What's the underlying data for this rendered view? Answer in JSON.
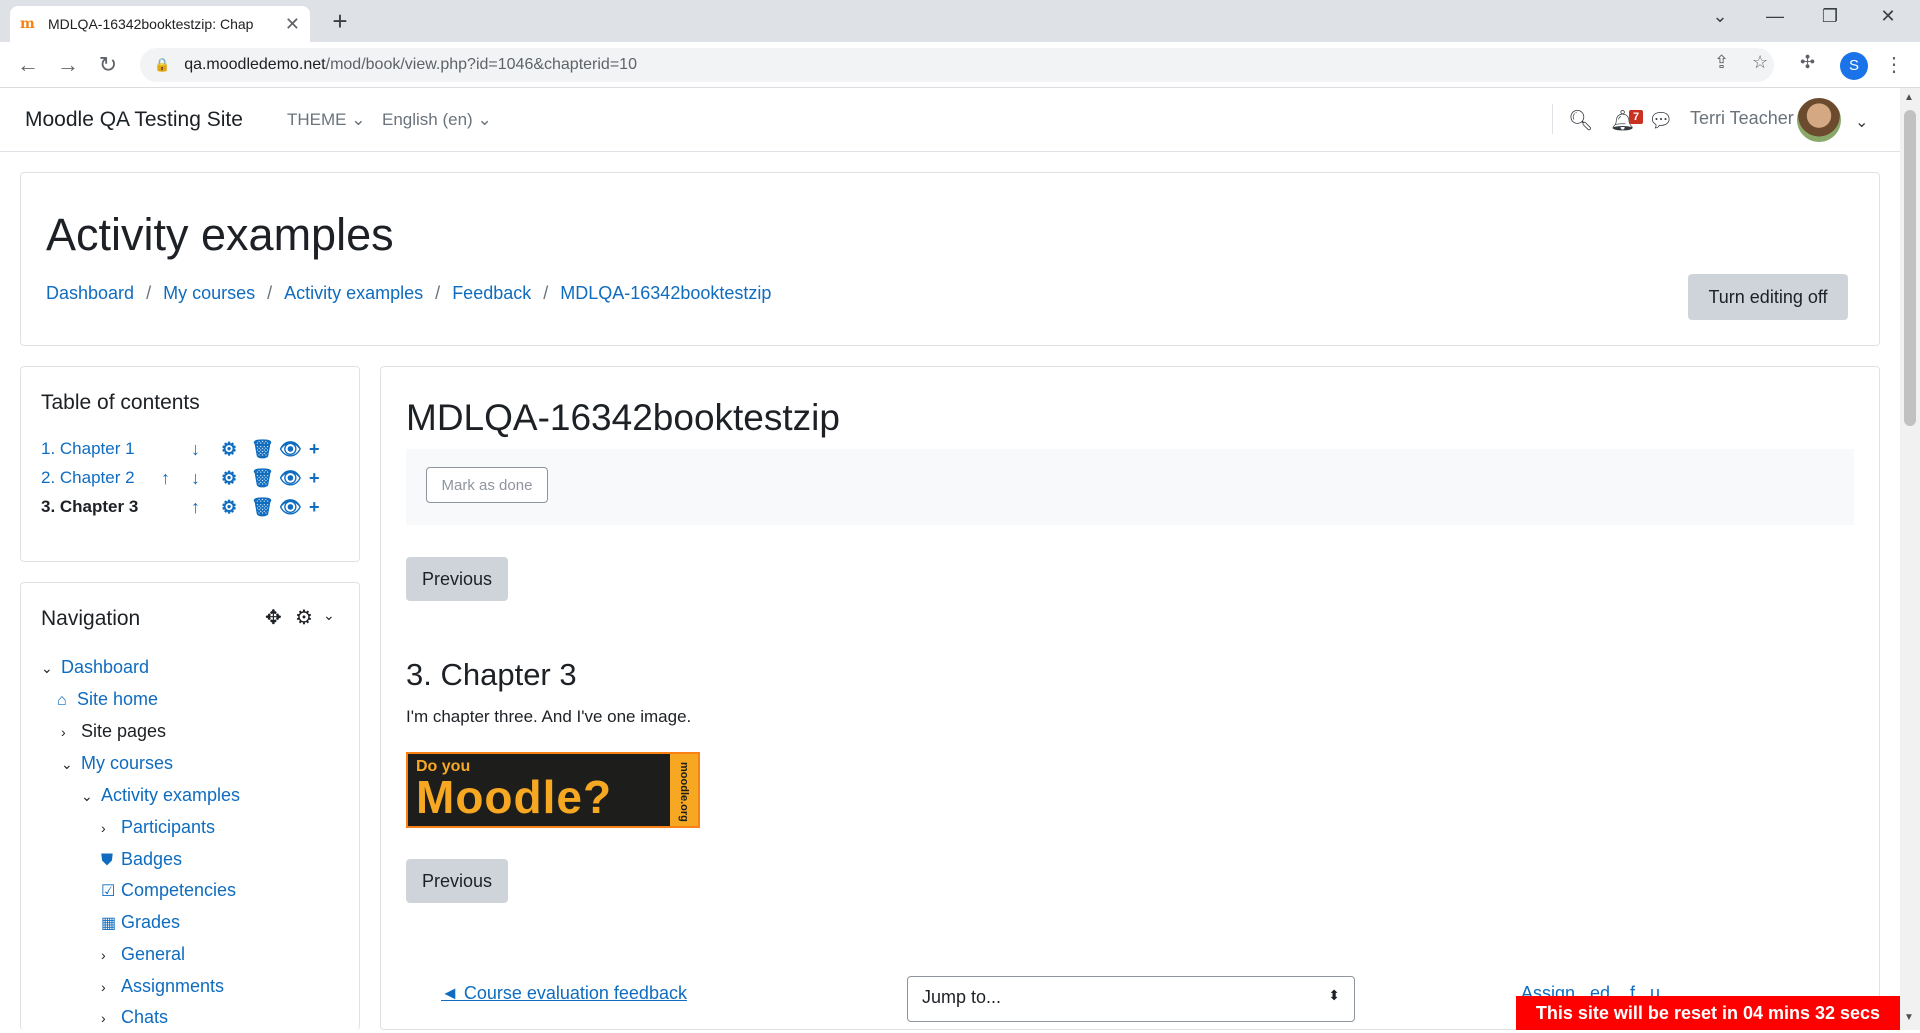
{
  "browser": {
    "tab_title": "MDLQA-16342booktestzip: Chap",
    "url_host": "qa.moodledemo.net",
    "url_path": "/mod/book/view.php?id=1046&chapterid=10",
    "profile_initial": "S"
  },
  "navbar": {
    "site_name": "Moodle QA Testing Site",
    "theme_label": "THEME",
    "language_label": "English (en)",
    "notification_count": "7",
    "user_name": "Terri Teacher"
  },
  "header": {
    "title": "Activity examples",
    "breadcrumb": [
      "Dashboard",
      "My courses",
      "Activity examples",
      "Feedback",
      "MDLQA-16342booktestzip"
    ],
    "edit_button": "Turn editing off"
  },
  "toc": {
    "title": "Table of contents",
    "chapters": [
      "1. Chapter 1",
      "2. Chapter 2",
      "3. Chapter 3"
    ]
  },
  "navigation": {
    "title": "Navigation",
    "items": [
      "Dashboard",
      "Site home",
      "Site pages",
      "My courses",
      "Activity examples",
      "Participants",
      "Badges",
      "Competencies",
      "Grades",
      "General",
      "Assignments",
      "Chats"
    ]
  },
  "main": {
    "title": "MDLQA-16342booktestzip",
    "mark_done": "Mark as done",
    "previous": "Previous",
    "chapter_title": "3. Chapter 3",
    "chapter_text": "I'm chapter three. And I've one image.",
    "image_small": "Do you",
    "image_big": "Moodle?",
    "image_side": "moodle.org",
    "footer_link": "◄ Course evaluation feedback",
    "jump_to": "Jump to...",
    "next_link_partial": "Assign...ed ...f...u..."
  },
  "reset_banner": "This site will be reset in 04 mins 32 secs"
}
